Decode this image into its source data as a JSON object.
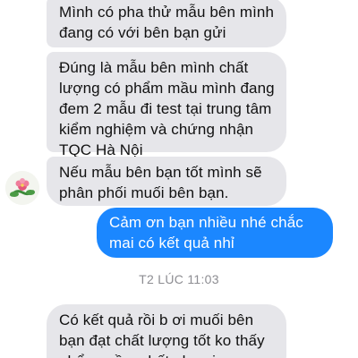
{
  "messages": [
    {
      "direction": "incoming",
      "lines": [
        "Mình có pha thử mẫu bên mình",
        "đang có với bên bạn gửi"
      ]
    },
    {
      "direction": "incoming",
      "lines": [
        "Đúng là mẫu bên mình chất",
        "lượng có phẩm mầu mình đang",
        "đem 2 mẫu đi test tại trung tâm",
        "kiểm nghiệm và chứng nhận",
        "TQC Hà Nội"
      ]
    },
    {
      "direction": "incoming",
      "lines": [
        "Nếu mẫu bên bạn tốt mình sẽ",
        "phân phối muối bên bạn."
      ]
    },
    {
      "direction": "outgoing",
      "lines": [
        "Cảm ơn bạn nhiều nhé chắc",
        "mai có kết quả nhỉ"
      ]
    },
    {
      "direction": "incoming",
      "lines": [
        "Có kết quả rồi b ơi muối bên",
        "bạn đạt chất lượng tốt ko thấy",
        "phẩm mầu, chất phụ gia"
      ]
    }
  ],
  "timestamp": "T2 LÚC 11:03",
  "colors": {
    "incoming_bubble": "#e6e6ea",
    "outgoing_bubble": "#1b87ff",
    "timestamp_text": "#8d8d92"
  }
}
